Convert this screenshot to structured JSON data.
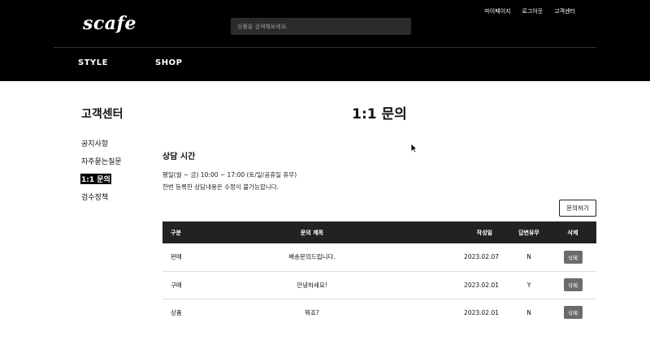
{
  "header": {
    "logo": "scafe",
    "search": {
      "placeholder": "상품을 검색해보세요.",
      "value": ""
    },
    "utils": [
      "마이페이지",
      "로그아웃",
      "고객센터"
    ],
    "nav": [
      "STYLE",
      "SHOP"
    ]
  },
  "sidebar": {
    "title": "고객센터",
    "items": [
      "공지사항",
      "자주묻는질문",
      "1:1 문의",
      "검수정책"
    ],
    "active_index": 2
  },
  "main": {
    "title": "1:1 문의",
    "section_title": "상담 시간",
    "info_lines": [
      "평일(월 ~ 금) 10:00 ~ 17:00 (토/일/공휴일 휴무)",
      "한번 등록한 상담내용은 수정이 불가능합니다."
    ],
    "ask_button": "문의하기"
  },
  "table": {
    "headers": [
      "구분",
      "문의 제목",
      "작성일",
      "답변유무",
      "삭제"
    ],
    "rows": [
      {
        "type": "판매",
        "title": "배송문의드립니다.",
        "date": "2023.02.07",
        "replied": "N",
        "delete": "삭제"
      },
      {
        "type": "구매",
        "title": "안녕하세요!",
        "date": "2023.02.01",
        "replied": "Y",
        "delete": "삭제"
      },
      {
        "type": "상품",
        "title": "뭐죠?",
        "date": "2023.02.01",
        "replied": "N",
        "delete": "삭제"
      }
    ]
  },
  "colors": {
    "header_bg": "#000000",
    "table_head_bg": "#222222",
    "delete_button": "#6b6b6b"
  }
}
